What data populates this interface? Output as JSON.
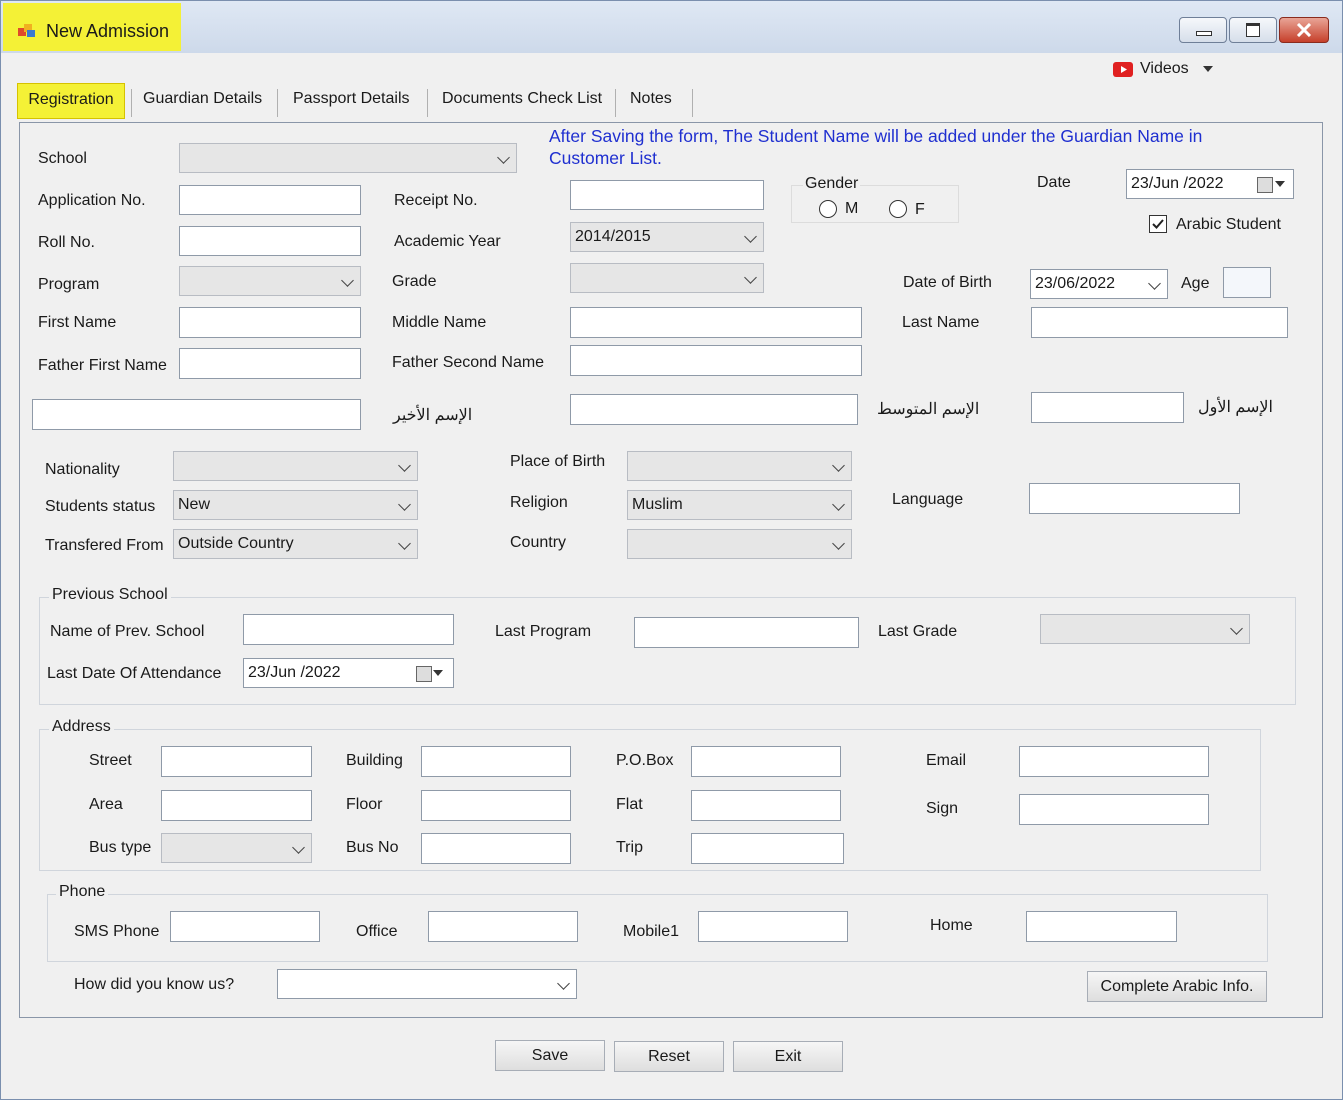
{
  "window": {
    "title": "New Admission"
  },
  "toolbar": {
    "videos_label": "Videos"
  },
  "tabs": [
    {
      "label": "Registration",
      "active": true
    },
    {
      "label": "Guardian Details"
    },
    {
      "label": "Passport Details"
    },
    {
      "label": "Documents Check List"
    },
    {
      "label": "Notes"
    }
  ],
  "notice": "After Saving the form, The Student Name will be added under the Guardian Name in Customer List.",
  "form": {
    "school_label": "School",
    "application_label": "Application No.",
    "receipt_label": "Receipt No.",
    "roll_label": "Roll No.",
    "academic_year_label": "Academic Year",
    "academic_year_value": "2014/2015",
    "program_label": "Program",
    "grade_label": "Grade",
    "gender_label": "Gender",
    "gender_m": "M",
    "gender_f": "F",
    "date_label": "Date",
    "date_value": "23/Jun /2022",
    "arabic_student_label": "Arabic Student",
    "dob_label": "Date of Birth",
    "dob_value": "23/06/2022",
    "age_label": "Age",
    "first_name_label": "First Name",
    "middle_name_label": "Middle Name",
    "last_name_label": "Last Name",
    "father_first_label": "Father First Name",
    "father_second_label": "Father Second Name",
    "arabic_last_label": "الإسم الأخير",
    "arabic_middle_label": "الإسم المتوسط",
    "arabic_first_label": "الإسم الأول",
    "nationality_label": "Nationality",
    "place_of_birth_label": "Place of Birth",
    "status_label": "Students status",
    "status_value": "New",
    "religion_label": "Religion",
    "religion_value": "Muslim",
    "language_label": "Language",
    "transferred_label": "Transfered From",
    "transferred_value": "Outside Country",
    "country_label": "Country"
  },
  "prev_school": {
    "group_label": "Previous School",
    "name_label": "Name of Prev. School",
    "last_program_label": "Last Program",
    "last_grade_label": "Last Grade",
    "last_date_label": "Last Date Of Attendance",
    "last_date_value": "23/Jun /2022"
  },
  "address": {
    "group_label": "Address",
    "street_label": "Street",
    "building_label": "Building",
    "pobox_label": "P.O.Box",
    "email_label": "Email",
    "area_label": "Area",
    "floor_label": "Floor",
    "flat_label": "Flat",
    "sign_label": "Sign",
    "bus_type_label": "Bus type",
    "bus_no_label": "Bus No",
    "trip_label": "Trip"
  },
  "phone": {
    "group_label": "Phone",
    "sms_label": "SMS Phone",
    "office_label": "Office",
    "mobile_label": "Mobile1",
    "home_label": "Home"
  },
  "how_know_label": "How did you know us?",
  "buttons": {
    "complete_arabic": "Complete Arabic Info.",
    "save": "Save",
    "reset": "Reset",
    "exit": "Exit"
  },
  "colors": {
    "highlight": "#f4f136",
    "notice_text": "#1f2fd0",
    "window_border": "#7a8fae"
  }
}
